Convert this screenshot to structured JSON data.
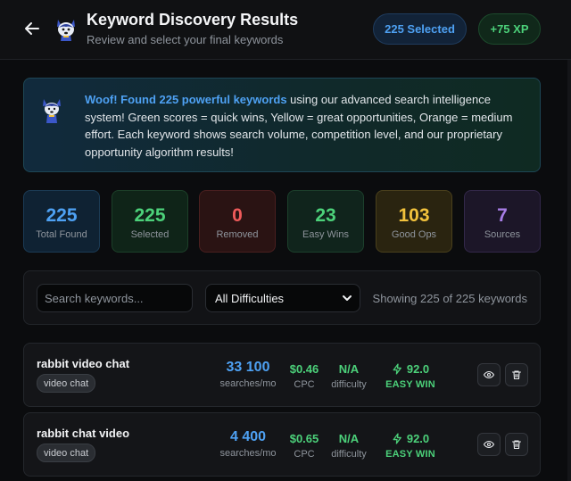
{
  "header": {
    "title": "Keyword Discovery Results",
    "subtitle": "Review and select your final keywords",
    "selected_pill": "225 Selected",
    "xp_pill": "+75 XP"
  },
  "banner": {
    "highlight": "Woof! Found 225 powerful keywords",
    "text": " using our advanced search intelligence system! Green scores = quick wins, Yellow = great opportunities, Orange = medium effort. Each keyword shows search volume, competition level, and our proprietary opportunity algorithm results!"
  },
  "stats": [
    {
      "value": "225",
      "label": "Total Found"
    },
    {
      "value": "225",
      "label": "Selected"
    },
    {
      "value": "0",
      "label": "Removed"
    },
    {
      "value": "23",
      "label": "Easy Wins"
    },
    {
      "value": "103",
      "label": "Good Ops"
    },
    {
      "value": "7",
      "label": "Sources"
    }
  ],
  "filters": {
    "search_placeholder": "Search keywords...",
    "difficulty_selected": "All Difficulties",
    "showing_text": "Showing 225 of 225 keywords"
  },
  "keywords": [
    {
      "keyword": "rabbit video chat",
      "tag": "video chat",
      "volume": "33 100",
      "volume_label": "searches/mo",
      "cpc": "$0.46",
      "cpc_label": "CPC",
      "difficulty": "N/A",
      "difficulty_label": "difficulty",
      "score": "92.0",
      "score_label": "EASY WIN"
    },
    {
      "keyword": "rabbit chat video",
      "tag": "video chat",
      "volume": "4 400",
      "volume_label": "searches/mo",
      "cpc": "$0.65",
      "cpc_label": "CPC",
      "difficulty": "N/A",
      "difficulty_label": "difficulty",
      "score": "92.0",
      "score_label": "EASY WIN"
    }
  ],
  "colors": {
    "blue": "#4ea1f3",
    "green": "#4cd17a",
    "red": "#ef5a5a",
    "yellow": "#f2c23c",
    "purple": "#a77de6"
  },
  "icons": {
    "back": "arrow-left-icon",
    "mascot": "husky-mascot-icon",
    "score": "lightning-icon",
    "view": "eye-icon",
    "delete": "trash-icon",
    "dropdown": "chevron-down-icon"
  }
}
